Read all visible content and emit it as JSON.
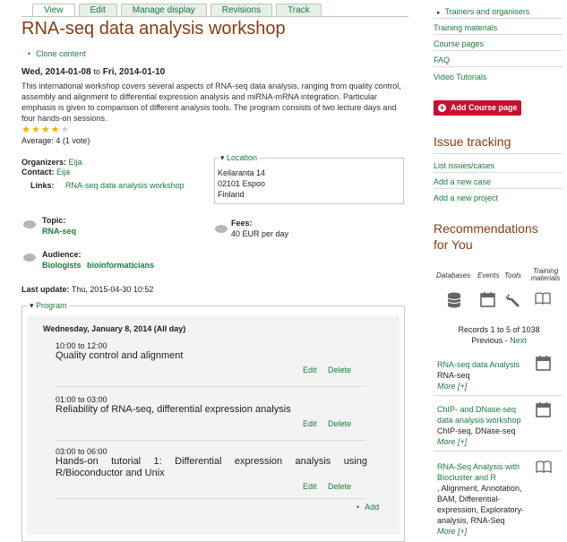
{
  "tabs": [
    "View",
    "Edit",
    "Manage display",
    "Revisions",
    "Track"
  ],
  "page": {
    "title": "RNA-seq data analysis workshop",
    "clone_link": "Clone content",
    "date_start": "Wed, 2014-01-08",
    "date_to": "to",
    "date_end": "Fri, 2014-01-10",
    "description": "This international workshop covers several aspects of RNA-seq data analysis, ranging from quality control, assembly and alignment to differential expression analysis and miRNA-mRNA integration. Particular emphasis is given to comparison of different analysis tools. The program consists of two lecture days and four hands-on sessions.",
    "rating_value": 4,
    "rating_max": 5,
    "average": "Average: 4 (1 vote)",
    "organizers_label": "Organizers:",
    "organizers": "Eija",
    "contact_label": "Contact:",
    "contact": "Eija",
    "links_label": "Links:",
    "links": "RNA-seq data analysis workshop",
    "location_label": "Location",
    "location_lines": [
      "Keilaranta 14",
      "02101 Espoo",
      "Finland"
    ],
    "topic_label": "Topic:",
    "topic": "RNA-seq",
    "fees_label": "Fees:",
    "fees": "40 EUR per day",
    "audience_label": "Audience:",
    "audience": [
      "Biologists",
      "bioinformaticians"
    ],
    "last_update_label": "Last update:",
    "last_update": "Thu, 2015-04-30 10:52"
  },
  "program": {
    "label": "Program",
    "day": "Wednesday, January 8, 2014 (All day)",
    "sessions": [
      {
        "time": "10:00 to 12:00",
        "title": "Quality control and alignment",
        "edit": "Edit",
        "delete": "Delete"
      },
      {
        "time": "01:00 to 03:00",
        "title": "Reliability of RNA-seq, differential expression analysis",
        "edit": "Edit",
        "delete": "Delete"
      },
      {
        "time": "03:00 to 06:00",
        "title": "Hands-on tutorial 1: Differential expression analysis using R/Bioconductor and Unix",
        "edit": "Edit",
        "delete": "Delete"
      }
    ],
    "add": "Add"
  },
  "sidebar": {
    "menu": [
      "Trainers and organisers",
      "Training materials",
      "Course pages",
      "FAQ",
      "Video Tutorials"
    ],
    "add_course": "Add Course page",
    "issue_heading": "Issue tracking",
    "issue_links": [
      "List issues/cases",
      "Add a new case",
      "Add a new project"
    ],
    "rec_heading_1": "Recommendations",
    "rec_heading_2": "for You",
    "rec_tabs": [
      "Databases",
      "Events",
      "Tools",
      "Training",
      "materials"
    ],
    "records": "Records 1 to 5 of 1038",
    "previous": "Previous",
    "sep": "-",
    "next": "Next",
    "recs": [
      {
        "title": "RNA-seq data Analysis",
        "sub": "RNA-seq",
        "more": "More [+]",
        "icon": "calendar-icon"
      },
      {
        "title": "ChIP- and DNase-seq data analysis workshop",
        "sub": "ChIP-seq, DNase-seq",
        "more": "More [+]",
        "icon": "calendar-icon"
      },
      {
        "title": "RNA-Seq Analysis with Biocluster and R",
        "sub": ", Alignment, Annotation, BAM, Differential-expression, Exploratory-analysis, RNA-Seq",
        "more": "More [+]",
        "icon": "book-icon"
      }
    ]
  }
}
